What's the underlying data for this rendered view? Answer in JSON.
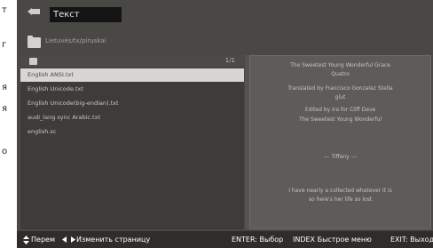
{
  "side_text": [
    "т",
    "г",
    "я",
    "я",
    "о"
  ],
  "header": {
    "title": "Текст"
  },
  "path": {
    "text": "Lietuvės/tx/piruskai"
  },
  "list": {
    "page_indicator": "1/1",
    "files": [
      {
        "name": "English ANSI.txt",
        "selected": true
      },
      {
        "name": "English Unicode.txt",
        "selected": false
      },
      {
        "name": "English Unicode(big-endian).txt",
        "selected": false
      },
      {
        "name": "audi_lang sync Arabic.txt",
        "selected": false
      },
      {
        "name": "english.sc",
        "selected": false
      }
    ]
  },
  "preview": {
    "lines": [
      "The Sweetest Young Wonderful Grace",
      "Quatro",
      "Translated by Francisco Gonzalez  Stella",
      "glut",
      "Edited by Ira for Cliff Dave",
      "The Sweetest Young Wonderful",
      "--- Tiffany ---",
      "I have nearly a collected whatever it is",
      "so here's her life so lost"
    ]
  },
  "footer": {
    "move": "Перем",
    "change_page": "Изменить страницу",
    "enter": "ENTER: Выбор",
    "index": "INDEX Быстрое меню",
    "exit": "EXIT: Выход"
  }
}
